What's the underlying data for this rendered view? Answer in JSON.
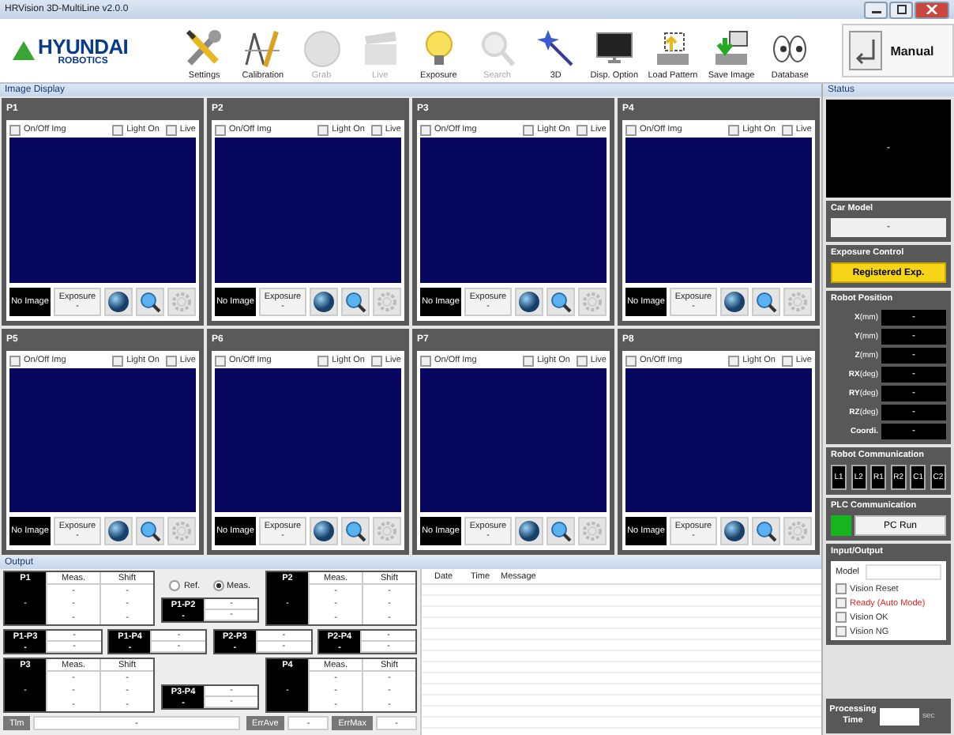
{
  "window": {
    "title": "HRVision 3D-MultiLine v2.0.0"
  },
  "logo": {
    "name": "HYUNDAI",
    "subtitle": "ROBOTICS"
  },
  "toolbar": {
    "buttons": [
      {
        "label": "Settings",
        "disabled": false
      },
      {
        "label": "Calibration",
        "disabled": false
      },
      {
        "label": "Grab",
        "disabled": true
      },
      {
        "label": "Live",
        "disabled": true
      },
      {
        "label": "Exposure",
        "disabled": false
      },
      {
        "label": "Search",
        "disabled": true
      },
      {
        "label": "3D",
        "disabled": false
      },
      {
        "label": "Disp. Option",
        "disabled": false
      },
      {
        "label": "Load Pattern",
        "disabled": false
      },
      {
        "label": "Save Image",
        "disabled": false
      },
      {
        "label": "Database",
        "disabled": false
      }
    ],
    "mode_button": "Manual"
  },
  "image_display": {
    "title": "Image Display",
    "panels": [
      {
        "title": "P1",
        "checkboxes": [
          {
            "label": "On/Off Img",
            "checked": false
          },
          {
            "label": "Light On",
            "checked": false
          },
          {
            "label": "Live",
            "checked": false
          }
        ],
        "status": "No Image",
        "exposure_label": "Exposure",
        "exposure_value": "-"
      },
      {
        "title": "P2",
        "checkboxes": [
          {
            "label": "On/Off Img",
            "checked": false
          },
          {
            "label": "Light On",
            "checked": false
          },
          {
            "label": "Live",
            "checked": false
          }
        ],
        "status": "No Image",
        "exposure_label": "Exposure",
        "exposure_value": "-"
      },
      {
        "title": "P3",
        "checkboxes": [
          {
            "label": "On/Off Img",
            "checked": false
          },
          {
            "label": "Light On",
            "checked": false
          },
          {
            "label": "Live",
            "checked": false
          }
        ],
        "status": "No Image",
        "exposure_label": "Exposure",
        "exposure_value": "-"
      },
      {
        "title": "P4",
        "checkboxes": [
          {
            "label": "On/Off Img",
            "checked": false
          },
          {
            "label": "Light On",
            "checked": false
          },
          {
            "label": "Live",
            "checked": false
          }
        ],
        "status": "No Image",
        "exposure_label": "Exposure",
        "exposure_value": "-"
      },
      {
        "title": "P5",
        "checkboxes": [
          {
            "label": "On/Off Img",
            "checked": false
          },
          {
            "label": "Light On",
            "checked": false
          },
          {
            "label": "Live",
            "checked": false
          }
        ],
        "status": "No Image",
        "exposure_label": "Exposure",
        "exposure_value": "-"
      },
      {
        "title": "P6",
        "checkboxes": [
          {
            "label": "On/Off Img",
            "checked": false
          },
          {
            "label": "Light On",
            "checked": false
          },
          {
            "label": "Live",
            "checked": false
          }
        ],
        "status": "No Image",
        "exposure_label": "Exposure",
        "exposure_value": "-"
      },
      {
        "title": "P7",
        "checkboxes": [
          {
            "label": "On/Off Img",
            "checked": false
          },
          {
            "label": "Light On",
            "checked": false
          },
          {
            "label": "Live",
            "checked": false
          }
        ],
        "status": "No Image",
        "exposure_label": "Exposure",
        "exposure_value": "-"
      },
      {
        "title": "P8",
        "checkboxes": [
          {
            "label": "On/Off Img",
            "checked": false
          },
          {
            "label": "Light On",
            "checked": false
          },
          {
            "label": "Live",
            "checked": false
          }
        ],
        "status": "No Image",
        "exposure_label": "Exposure",
        "exposure_value": "-"
      }
    ]
  },
  "output": {
    "title": "Output",
    "point_blocks": [
      {
        "label": "P1",
        "value": "-",
        "columns": [
          "Meas.",
          "Shift"
        ],
        "rows": [
          [
            "-",
            "-"
          ],
          [
            "-",
            "-"
          ],
          [
            "-",
            "-"
          ]
        ]
      },
      {
        "label": "P2",
        "value": "-",
        "columns": [
          "Meas.",
          "Shift"
        ],
        "rows": [
          [
            "-",
            "-"
          ],
          [
            "-",
            "-"
          ],
          [
            "-",
            "-"
          ]
        ]
      },
      {
        "label": "P3",
        "value": "-",
        "columns": [
          "Meas.",
          "Shift"
        ],
        "rows": [
          [
            "-",
            "-"
          ],
          [
            "-",
            "-"
          ],
          [
            "-",
            "-"
          ]
        ]
      },
      {
        "label": "P4",
        "value": "-",
        "columns": [
          "Meas.",
          "Shift"
        ],
        "rows": [
          [
            "-",
            "-"
          ],
          [
            "-",
            "-"
          ],
          [
            "-",
            "-"
          ]
        ]
      }
    ],
    "mode_options": [
      {
        "label": "Ref.",
        "selected": false
      },
      {
        "label": "Meas.",
        "selected": true
      }
    ],
    "pair_blocks": [
      {
        "label": "P1-P2",
        "value": "-",
        "readings": [
          "-",
          "-"
        ]
      },
      {
        "label": "P1-P3",
        "value": "-",
        "readings": [
          "-",
          "-"
        ]
      },
      {
        "label": "P1-P4",
        "value": "-",
        "readings": [
          "-",
          "-"
        ]
      },
      {
        "label": "P2-P3",
        "value": "-",
        "readings": [
          "-",
          "-"
        ]
      },
      {
        "label": "P2-P4",
        "value": "-",
        "readings": [
          "-",
          "-"
        ]
      },
      {
        "label": "P3-P4",
        "value": "-",
        "readings": [
          "-",
          "-"
        ]
      }
    ],
    "footer": [
      {
        "label": "Tlm",
        "value": "-"
      },
      {
        "label": "ErrAve",
        "value": "-"
      },
      {
        "label": "ErrMax",
        "value": "-"
      }
    ]
  },
  "log": {
    "columns": [
      "Date",
      "Time",
      "Message"
    ]
  },
  "status": {
    "title": "Status",
    "display": "-",
    "car_model": {
      "title": "Car Model",
      "value": "-"
    },
    "exposure_control": {
      "title": "Exposure Control",
      "button": "Registered Exp."
    },
    "robot_position": {
      "title": "Robot Position",
      "rows": [
        {
          "label": "X",
          "unit": "(mm)",
          "value": "-"
        },
        {
          "label": "Y",
          "unit": "(mm)",
          "value": "-"
        },
        {
          "label": "Z",
          "unit": "(mm)",
          "value": "-"
        },
        {
          "label": "RX",
          "unit": "(deg)",
          "value": "-"
        },
        {
          "label": "RY",
          "unit": "(deg)",
          "value": "-"
        },
        {
          "label": "RZ",
          "unit": "(deg)",
          "value": "-"
        },
        {
          "label": "Coordi.",
          "value": "-"
        }
      ]
    },
    "robot_communication": {
      "title": "Robot Communication",
      "channels": [
        "L1",
        "L2",
        "R1",
        "R2",
        "C1",
        "C2"
      ]
    },
    "plc_communication": {
      "title": "PLC Communication",
      "connected": true,
      "button": "PC Run"
    },
    "input_output": {
      "title": "Input/Output",
      "model_label": "Model",
      "signals": [
        {
          "label": "Vision Reset",
          "checked": false,
          "alert": false
        },
        {
          "label": "Ready (Auto Mode)",
          "checked": false,
          "alert": true
        },
        {
          "label": "Vision OK",
          "checked": false,
          "alert": false
        },
        {
          "label": "Vision NG",
          "checked": false,
          "alert": false
        }
      ]
    },
    "processing_time": {
      "label": "Processing Time",
      "unit": "sec"
    }
  }
}
